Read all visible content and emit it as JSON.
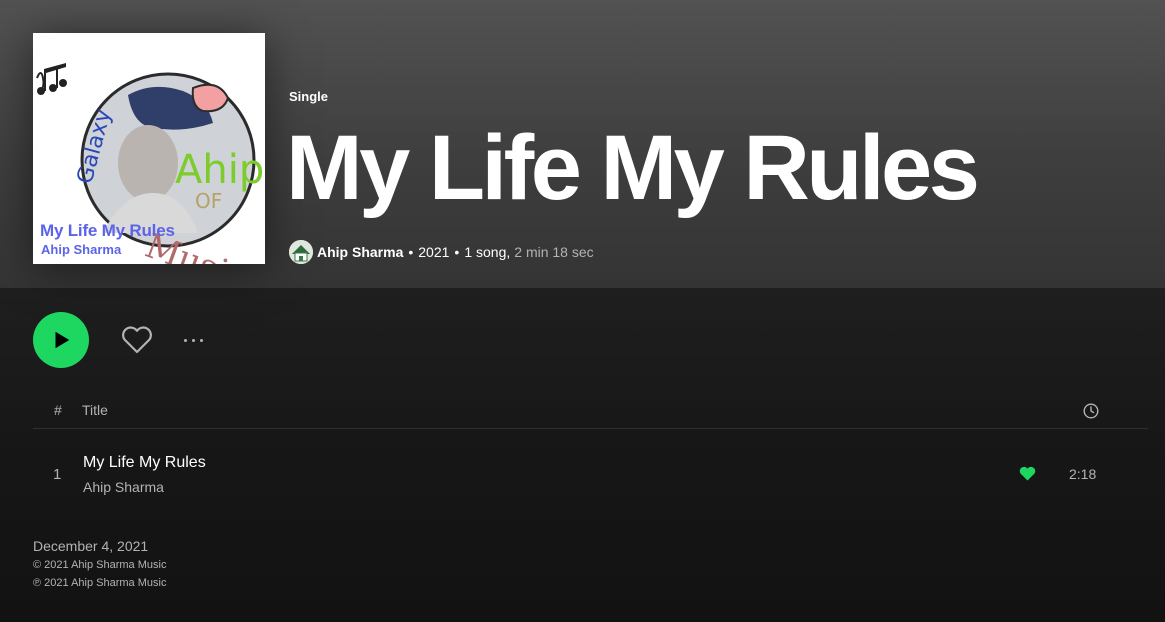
{
  "album": {
    "type": "Single",
    "title": "My Life My Rules",
    "artist": "Ahip Sharma",
    "year": "2021",
    "song_count": "1 song,",
    "duration": "2 min 18 sec",
    "separator": "•"
  },
  "cover": {
    "title_text": "My Life My Rules",
    "artist_text": "Ahip Sharma",
    "logo_word_1": "Galaxy",
    "logo_word_2": "Ahip",
    "logo_word_3": "OF",
    "logo_word_4": "Music"
  },
  "controls": {
    "play_icon": "play-icon",
    "like_icon": "heart-outline-icon",
    "more_icon": "more-horizontal-icon"
  },
  "tracklist": {
    "header": {
      "number": "#",
      "title": "Title",
      "duration_icon": "clock-icon"
    },
    "tracks": [
      {
        "number": "1",
        "title": "My Life My Rules",
        "artist": "Ahip Sharma",
        "liked": true,
        "duration": "2:18"
      }
    ]
  },
  "footer": {
    "release_date": "December 4, 2021",
    "copyright": "© 2021 Ahip Sharma Music",
    "phonographic": "℗ 2021 Ahip Sharma Music"
  },
  "colors": {
    "accent": "#1ed760",
    "background": "#121212",
    "header_bg": "#525252",
    "secondary_text": "#b3b3b3"
  }
}
